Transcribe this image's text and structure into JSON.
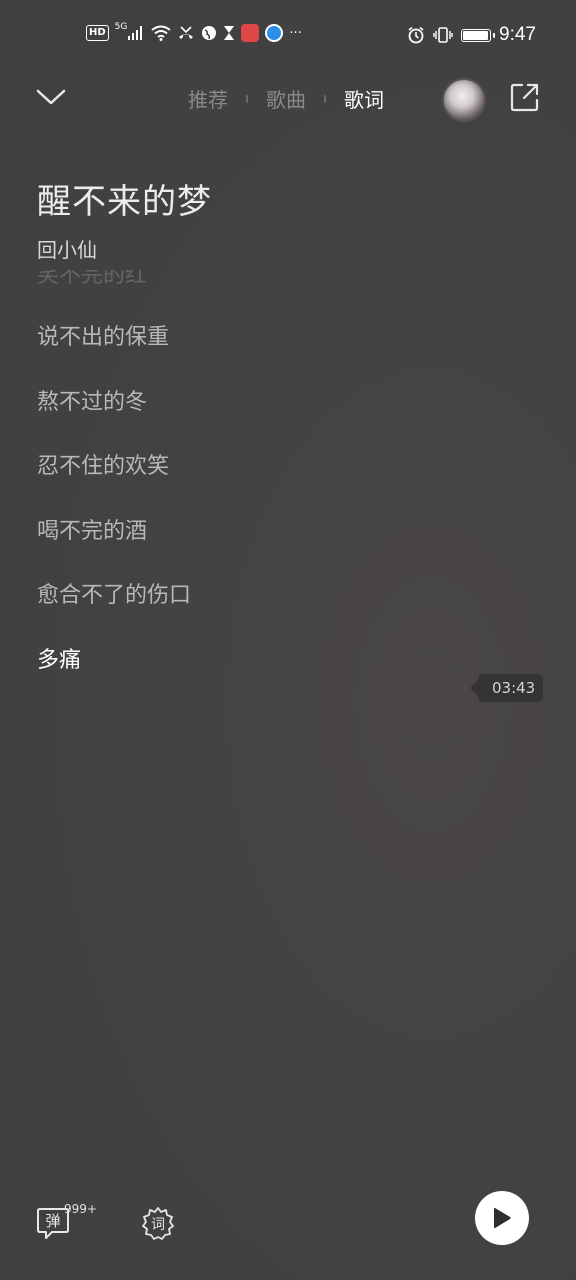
{
  "status_bar": {
    "left_icons": [
      "hd-icon",
      "5g-signal-icon",
      "wifi-icon",
      "missed-call-icon",
      "globe-icon",
      "hourglass-icon",
      "red-app-icon",
      "blue-app-icon",
      "more-notifications-icon"
    ],
    "hd": "HD",
    "network": "5G",
    "more": "···",
    "right_icons": [
      "alarm-icon",
      "vibrate-icon",
      "battery-icon"
    ],
    "battery_level": 0.95,
    "time": "9:47"
  },
  "topbar": {
    "tabs": [
      {
        "label": "推荐"
      },
      {
        "label": "歌曲"
      },
      {
        "label": "歌词"
      }
    ],
    "active_tab": "歌词"
  },
  "song": {
    "title": "醒不来的梦",
    "artist": "回小仙"
  },
  "lyrics": {
    "faded": "笑不完的红",
    "lines": [
      "说不出的保重",
      "熬不过的冬",
      "忍不住的欢笑",
      "喝不完的酒",
      "愈合不了的伤口"
    ],
    "current": "多痛",
    "timestamp": "03:43"
  },
  "bottom": {
    "danmu_icon_text": "弹",
    "danmu_count": "999+",
    "lyric_icon_text": "词"
  },
  "colors": {
    "background": "#444242",
    "active_text": "#ffffff",
    "inactive_text": "#8a8888"
  }
}
